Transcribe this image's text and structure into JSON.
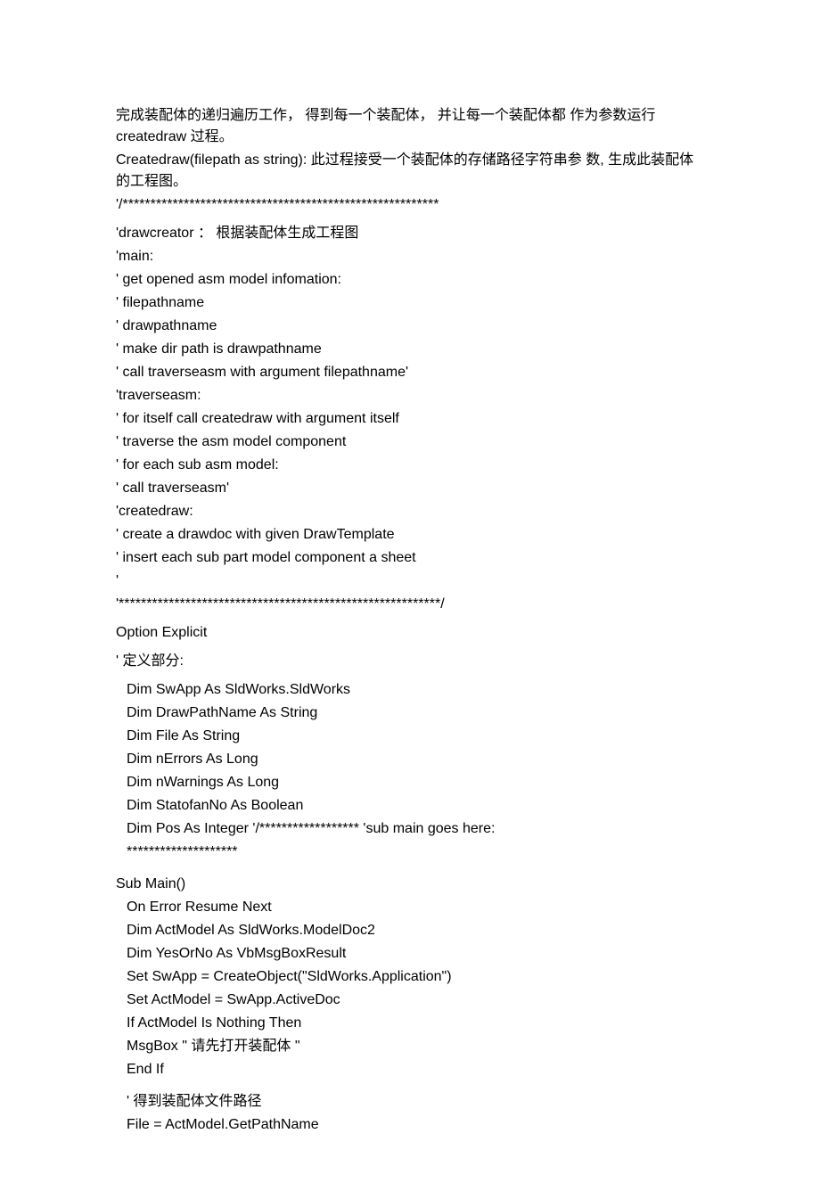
{
  "content": {
    "p1": "完成装配体的递归遍历工作，   得到每一个装配体，   并让每一个装配体都  作为参数运行  createdraw 过程。",
    "p2": "Createdraw(filepath as string): 此过程接受一个装配体的存储路径字符串参  数,   生成此装配体的工程图。",
    "p3": "'/*********************************************************",
    "p4": "'drawcreator ：   根据装配体生成工程图",
    "p5": "'main:",
    "p6": "' get opened asm model infomation:",
    "p7": "' filepathname",
    "p8": "' drawpathname",
    "p9": "' make dir path is drawpathname",
    "p10": "' call traverseasm with argument filepathname'",
    "p11": "'traverseasm:",
    "p12": "' for itself call createdraw with argument itself",
    "p13": "' traverse the asm model component",
    "p14": "' for each sub asm model:",
    "p15": "'        call traverseasm'",
    "p16": "'createdraw:",
    "p17": "' create a drawdoc with given DrawTemplate",
    "p18a": "' insert each sub part model component a sheet",
    "p18b": "'",
    "p19": "'**********************************************************/",
    "p20": "Option Explicit",
    "p21": "' 定义部分:",
    "p22": "Dim SwApp        As SldWorks.SldWorks",
    "p23": "Dim DrawPathName As String",
    "p24": "Dim File         As String",
    "p25": "Dim nErrors       As Long",
    "p26": "Dim nWarnings     As Long",
    "p27": "Dim StatofanNo As Boolean",
    "p28a": "Dim Pos As Integer '/****************** 'sub main goes here:",
    "p28b": "********************",
    "p29": "Sub Main()",
    "p30": "On Error Resume Next",
    "p31": "Dim ActModel As SldWorks.ModelDoc2",
    "p32": "Dim YesOrNo As VbMsgBoxResult",
    "p33": "Set SwApp = CreateObject(\"SldWorks.Application\")",
    "p34": "Set ActModel = SwApp.ActiveDoc",
    "p35": "If ActModel Is Nothing Then",
    "p36": "  MsgBox \" 请先打开装配体  \"",
    "p37": "End If",
    "p38": "' 得到装配体文件路径",
    "p39": "File = ActModel.GetPathName"
  }
}
